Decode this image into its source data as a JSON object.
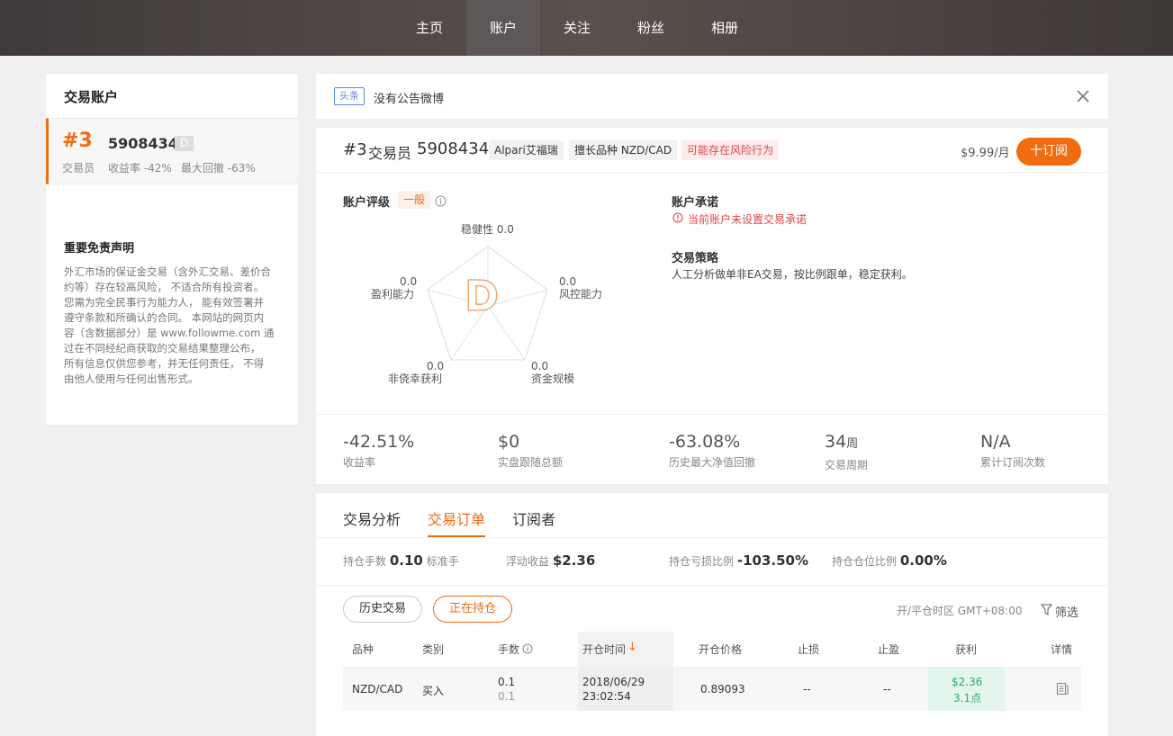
{
  "nav": {
    "items": [
      "主页",
      "账户",
      "关注",
      "粉丝",
      "相册"
    ],
    "active": "账户"
  },
  "left": {
    "title": "交易账户",
    "account": {
      "rank": "#3",
      "id": "5908434",
      "grade_badge": "D",
      "role": "交易员",
      "return_rate": "收益率 -42%",
      "max_drawdown": "最大回撤 -63%"
    },
    "disclaimer": {
      "title": "重要免责声明",
      "lines": [
        "外汇市场的保证金交易（含外汇交易、差价合",
        "约等）存在较高风险， 不适合所有投资者。",
        "您需为完全民事行为能力人， 能有效签署并",
        "遵守条款和所确认的合同。 本网站的网页内",
        "容（含数据部分）是 www.followme.com 通",
        "过在不同经纪商获取的交易结果整理公布，",
        "所有信息仅供您参考，并无任何责任， 不得",
        "由他人使用与任何出售形式。"
      ]
    }
  },
  "notice": {
    "badge": "头条",
    "text": "没有公告微博"
  },
  "header": {
    "rank": "#3",
    "role": "交易员",
    "id": "5908434",
    "broker": "Alpari艾福瑞",
    "specialty": "擅长品种 NZD/CAD",
    "risk": "可能存在风险行为",
    "price": "$9.99/月",
    "subscribe_label": "十订阅"
  },
  "rating": {
    "label": "账户评级",
    "level": "一般",
    "grade": "D",
    "axes": [
      {
        "name": "稳健性",
        "value": "0.0"
      },
      {
        "name": "风控能力",
        "value": "0.0"
      },
      {
        "name": "资金规模",
        "value": "0.0"
      },
      {
        "name": "非侥幸获利",
        "value": "0.0"
      },
      {
        "name": "盈利能力",
        "value": "0.0"
      }
    ]
  },
  "commitment": {
    "title": "账户承诺",
    "text": "当前账户未设置交易承诺"
  },
  "strategy": {
    "title": "交易策略",
    "text": "人工分析做单非EA交易，按比例跟单，稳定获利。"
  },
  "stats": [
    {
      "value": "-42.51%",
      "unit": "",
      "label": "收益率"
    },
    {
      "value": "$0",
      "unit": "",
      "label": "实盘跟随总额"
    },
    {
      "value": "-63.08%",
      "unit": "",
      "label": "历史最大净值回撤"
    },
    {
      "value": "34",
      "unit": "周",
      "label": "交易周期"
    },
    {
      "value": "N/A",
      "unit": "",
      "label": "累计订阅次数"
    }
  ],
  "tabs": [
    {
      "label": "交易分析"
    },
    {
      "label": "交易订单"
    },
    {
      "label": "订阅者"
    }
  ],
  "summary": [
    {
      "label": "持仓手数",
      "value": "0.10",
      "suffix": "标准手"
    },
    {
      "label": "浮动收益",
      "value": "$2.36",
      "suffix": ""
    },
    {
      "label": "持仓亏损比例",
      "value": "-103.50%",
      "suffix": ""
    },
    {
      "label": "持仓仓位比例",
      "value": "0.00%",
      "suffix": ""
    }
  ],
  "filters": {
    "history": "历史交易",
    "open": "正在持仓",
    "timezone": "开/平仓时区 GMT+08:00",
    "filter": "筛选"
  },
  "table": {
    "headers": [
      "品种",
      "类别",
      "手数",
      "开仓时间",
      "开仓价格",
      "止损",
      "止盈",
      "获利",
      "详情"
    ],
    "rows": [
      {
        "symbol": "NZD/CAD",
        "type": "买入",
        "lots": "0.1",
        "lots2": "0.1",
        "date": "2018/06/29",
        "time": "23:02:54",
        "price": "0.89093",
        "sl": "--",
        "tp": "--",
        "profit": "$2.36",
        "points": "3.1点"
      }
    ]
  },
  "colors": {
    "accent": "#f26b10",
    "profit_bg": "#e3f5ed",
    "profit": "#2fa875",
    "risk": "#e0464b"
  }
}
